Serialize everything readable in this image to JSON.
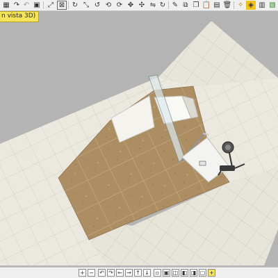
{
  "view_mode_label": "n vista 3D)",
  "icons": {
    "top_toolbar": [
      "grid-icon",
      "redo-icon",
      "undo-icon",
      "undo-disabled-icon",
      "lock-icon",
      "zoom-extents-icon",
      "rotate-icon",
      "expand-icon",
      "rotate-left-icon",
      "rotate-3d-icon",
      "move-icon",
      "pan-icon",
      "flip-icon",
      "rotate-right-icon",
      "measure-icon",
      "copy-icon",
      "paste-icon",
      "clipboard-icon",
      "delete-icon",
      "package-icon",
      "cube-icon",
      "lock-2-icon",
      "pdf-icon",
      "save-icon",
      "export-icon"
    ],
    "bottom_toolbar": [
      "zoom-in-icon",
      "zoom-out-icon",
      "rotate-left-icon",
      "rotate-right-icon",
      "arrow-left-icon",
      "arrow-right-icon",
      "arrow-up-icon",
      "arrow-down-icon",
      "view-1-icon",
      "view-2-icon",
      "view-3-icon",
      "view-4-icon",
      "view-5-icon",
      "view-6-icon",
      "view-7-icon",
      "add-icon"
    ]
  },
  "colors": {
    "background": "#b4b4b4",
    "floor_tile": "#ad8e62",
    "wall_tile": "#ebe9df",
    "glass": "#dde9ec",
    "view_label_bg": "#f5e45a"
  }
}
